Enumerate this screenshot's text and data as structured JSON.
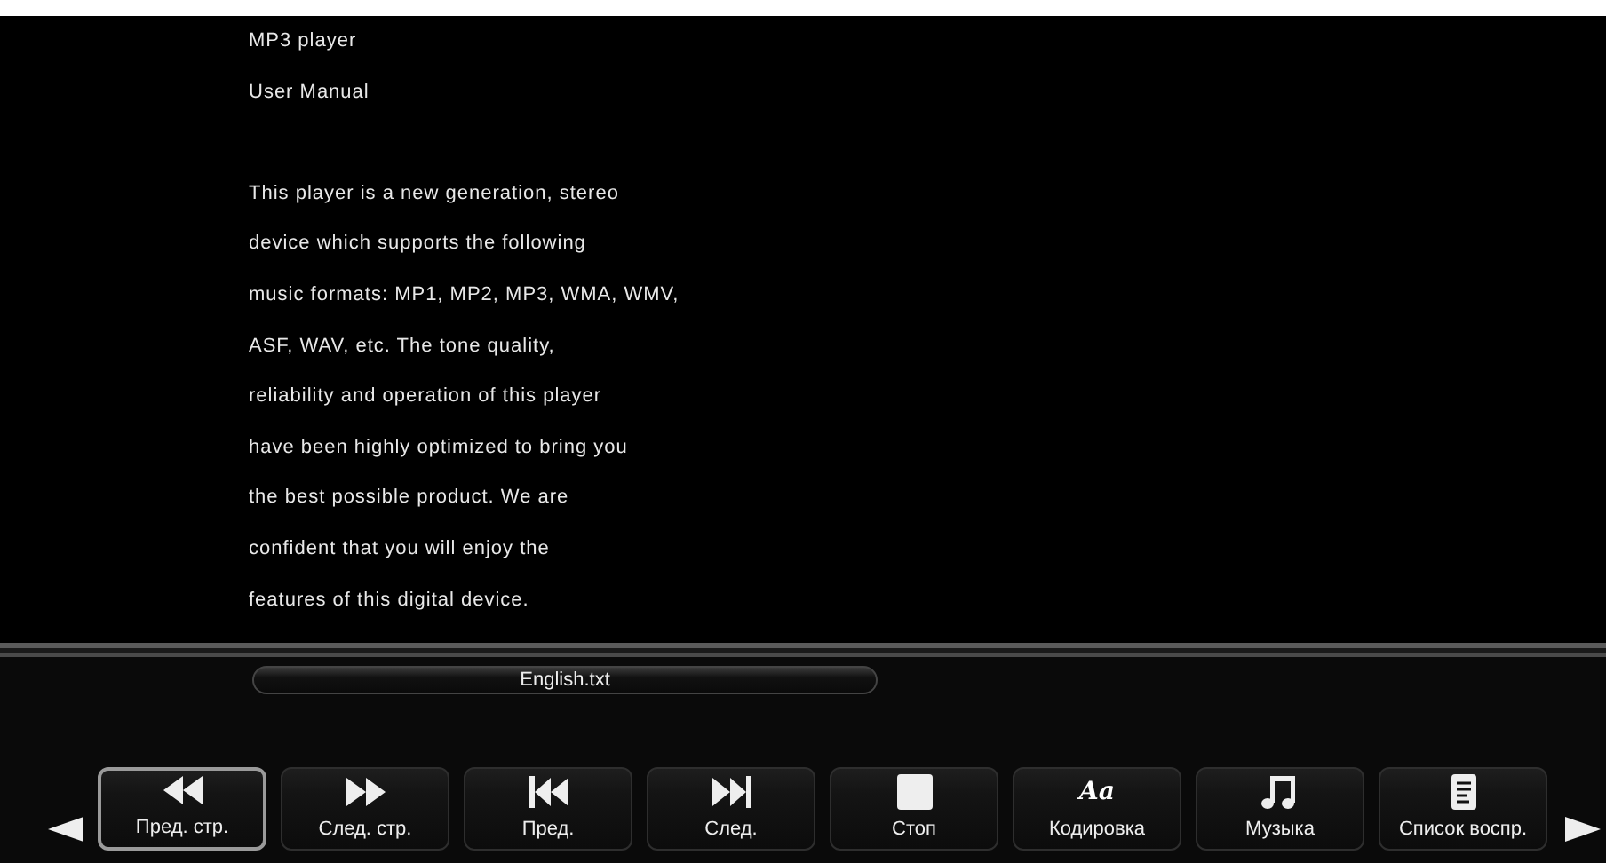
{
  "document": {
    "heading_lines": [
      "MP3 player",
      "User Manual"
    ],
    "body_lines": [
      "This player is a new generation, stereo",
      "device which supports the following",
      "music formats: MP1, MP2, MP3, WMA, WMV,",
      "ASF, WAV, etc. The tone quality,",
      "reliability and operation of this player",
      "have been highly optimized to bring you",
      "the best possible product. We are",
      "confident that you will enjoy the",
      "features of this digital device."
    ]
  },
  "file_name": "English.txt",
  "toolbar": [
    {
      "label": "Пред. стр.",
      "kind": "rewind",
      "selected": true
    },
    {
      "label": "След. стр.",
      "kind": "forward",
      "selected": false
    },
    {
      "label": "Пред.",
      "kind": "previous",
      "selected": false
    },
    {
      "label": "След.",
      "kind": "next",
      "selected": false
    },
    {
      "label": "Стоп",
      "kind": "stop",
      "selected": false
    },
    {
      "label": "Кодировка",
      "kind": "glyph",
      "glyph": "Aa",
      "selected": false
    },
    {
      "label": "Музыка",
      "kind": "music",
      "selected": false
    },
    {
      "label": "Список воспр.",
      "kind": "playlist",
      "selected": false
    }
  ]
}
